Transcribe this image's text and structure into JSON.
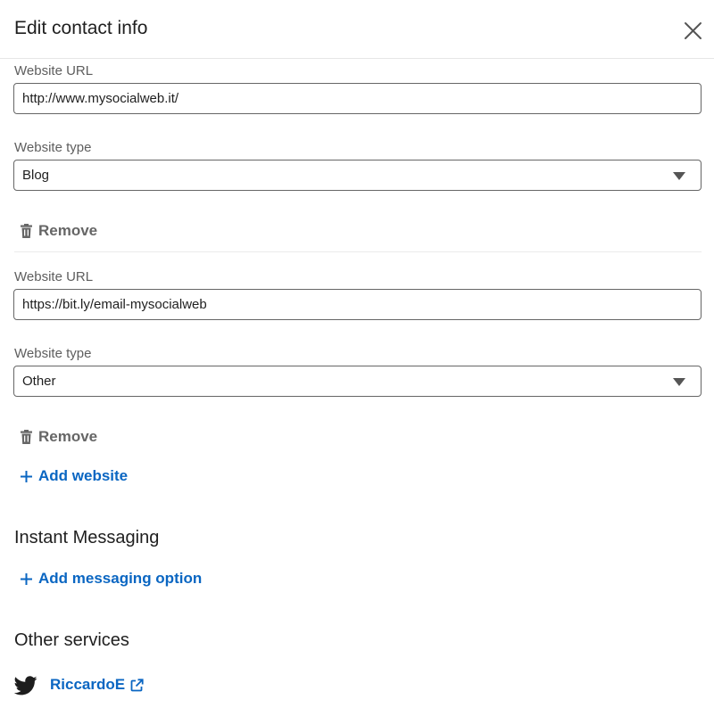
{
  "dialog": {
    "title": "Edit contact info",
    "close_icon": "close-icon"
  },
  "websites": [
    {
      "url_label": "Website URL",
      "url_value": "http://www.mysocialweb.it/",
      "type_label": "Website type",
      "type_value": "Blog",
      "remove_label": "Remove"
    },
    {
      "url_label": "Website URL",
      "url_value": "https://bit.ly/email-mysocialweb",
      "type_label": "Website type",
      "type_value": "Other",
      "remove_label": "Remove"
    }
  ],
  "add_website_label": "Add website",
  "instant_messaging": {
    "heading": "Instant Messaging",
    "add_label": "Add messaging option"
  },
  "other_services": {
    "heading": "Other services",
    "twitter_handle": "RiccardoE"
  },
  "colors": {
    "link_blue": "#0a66c2",
    "muted_gray": "#666666",
    "label_gray": "#5e5e5e"
  }
}
